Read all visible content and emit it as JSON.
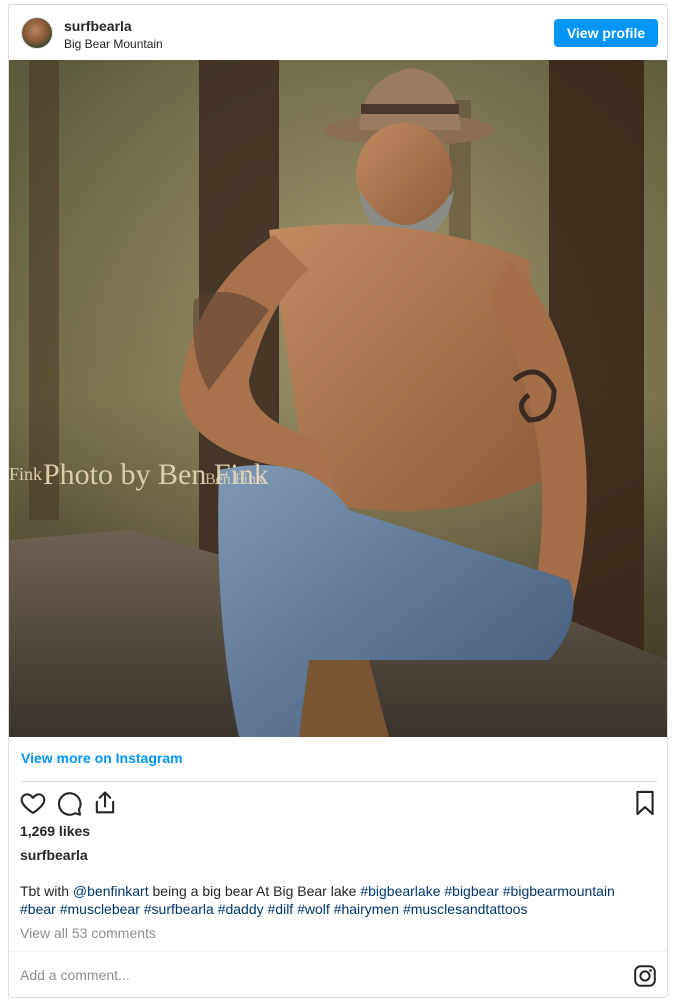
{
  "header": {
    "username": "surfbearla",
    "location": "Big Bear Mountain",
    "view_profile_label": "View profile"
  },
  "photo": {
    "watermark_text": "Photo by Ben Fink",
    "watermark_left": "Fink",
    "watermark_small": "Ben Fink"
  },
  "view_more_label": "View more on Instagram",
  "actions": {
    "icons": [
      "heart-icon",
      "comment-icon",
      "share-icon",
      "bookmark-icon"
    ]
  },
  "likes_text": "1,269 likes",
  "owner_name": "surfbearla",
  "caption": {
    "prefix": "Tbt with ",
    "mention": "@benfinkart",
    "middle": " being a big bear At Big Bear lake ",
    "hashtags_line1": [
      "#bigbearlake",
      "#bigbear",
      "#bigbearmountain"
    ],
    "hashtags_line2": [
      "#bear",
      "#musclebear",
      "#surfbearla",
      "#daddy",
      "#dilf",
      "#wolf",
      "#hairymen",
      "#musclesandtattoos"
    ]
  },
  "comments_link": "View all 53 comments",
  "add_comment_placeholder": "Add a comment...",
  "colors": {
    "accent": "#0095f6",
    "hashtag": "#00376b",
    "muted": "#8e8e8e",
    "border": "#dbdbdb"
  }
}
